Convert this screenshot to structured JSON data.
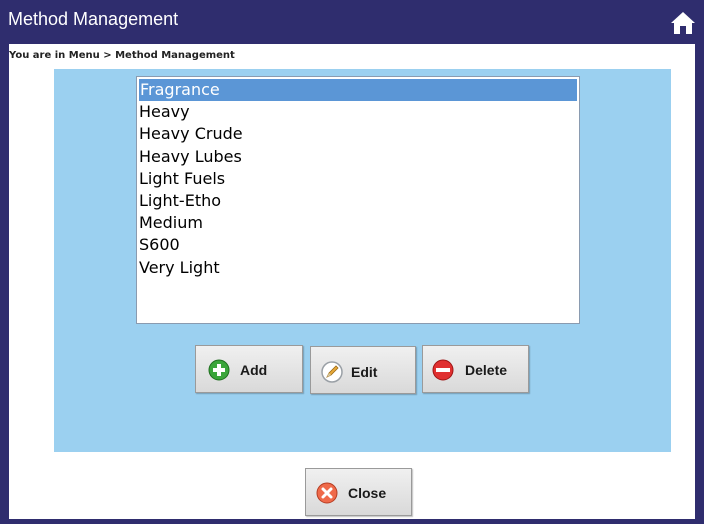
{
  "window": {
    "title": "Method Management",
    "home_icon": "home-icon",
    "colors": {
      "titlebar": "#2f2d6e",
      "panel": "#9bd0f0",
      "selection": "#5b96d6"
    }
  },
  "breadcrumb": {
    "text": "You are in  Menu > Method Management"
  },
  "methods": {
    "items": [
      "Fragrance",
      "Heavy",
      "Heavy Crude",
      "Heavy Lubes",
      "Light Fuels",
      "Light-Etho",
      "Medium",
      "S600",
      "Very Light"
    ],
    "selected": "Fragrance"
  },
  "actions": {
    "add_label": "Add",
    "add_icon": "plus-circle-icon",
    "edit_label": "Edit",
    "edit_icon": "pencil-icon",
    "delete_label": "Delete",
    "delete_icon": "minus-circle-icon",
    "close_label": "Close",
    "close_icon": "x-circle-icon"
  }
}
